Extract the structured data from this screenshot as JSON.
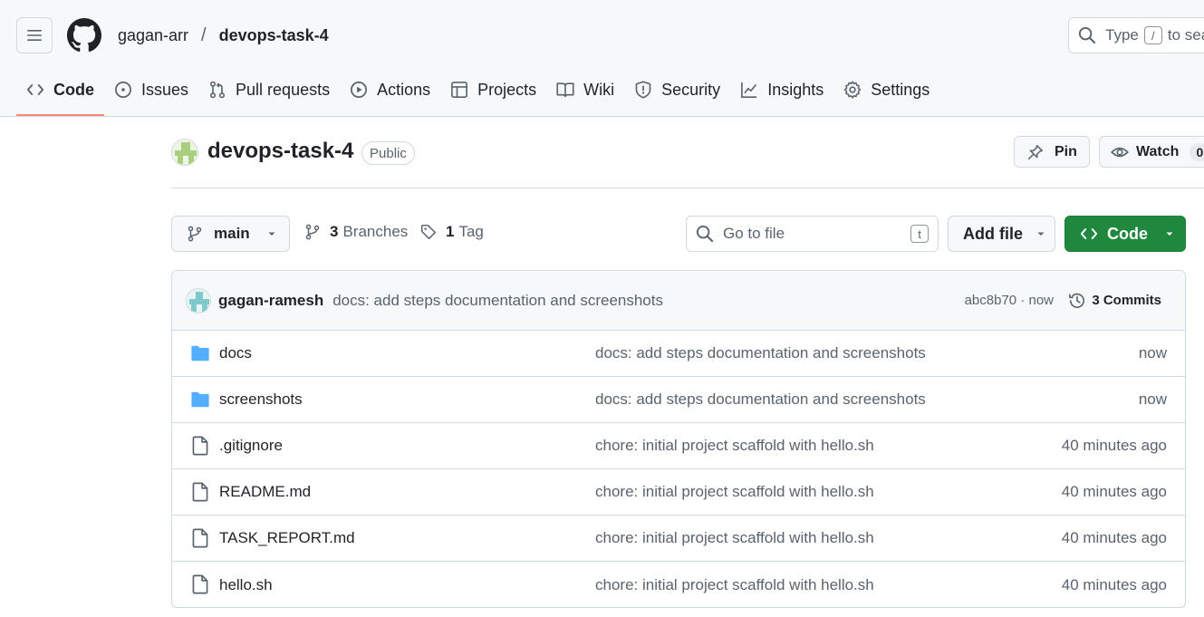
{
  "header": {
    "owner": "gagan-arr",
    "separator": "/",
    "repo": "devops-task-4",
    "search_prefix": "Type",
    "search_key": "/",
    "search_suffix": "to sea"
  },
  "tabs": [
    {
      "label": "Code",
      "icon": "code-icon",
      "selected": true
    },
    {
      "label": "Issues",
      "icon": "issue-icon"
    },
    {
      "label": "Pull requests",
      "icon": "pull-request-icon"
    },
    {
      "label": "Actions",
      "icon": "play-icon"
    },
    {
      "label": "Projects",
      "icon": "table-icon"
    },
    {
      "label": "Wiki",
      "icon": "book-icon"
    },
    {
      "label": "Security",
      "icon": "shield-icon"
    },
    {
      "label": "Insights",
      "icon": "graph-icon"
    },
    {
      "label": "Settings",
      "icon": "gear-icon"
    }
  ],
  "repo_header": {
    "name": "devops-task-4",
    "visibility": "Public",
    "pin_label": "Pin",
    "watch_label": "Watch",
    "watch_count": "0"
  },
  "toolbar": {
    "branch": "main",
    "branches_count": "3",
    "branches_label": "Branches",
    "tags_count": "1",
    "tags_label": "Tag",
    "goto_placeholder": "Go to file",
    "goto_key": "t",
    "add_file_label": "Add file",
    "code_label": "Code"
  },
  "latest_commit": {
    "author": "gagan-ramesh",
    "message": "docs: add steps documentation and screenshots",
    "meta": "abc8b70 · now",
    "commits_label": "3 Commits"
  },
  "files": [
    {
      "type": "folder",
      "name": "docs",
      "message": "docs: add steps documentation and screenshots",
      "time": "now"
    },
    {
      "type": "folder",
      "name": "screenshots",
      "message": "docs: add steps documentation and screenshots",
      "time": "now"
    },
    {
      "type": "file",
      "name": ".gitignore",
      "message": "chore: initial project scaffold with hello.sh",
      "time": "40 minutes ago"
    },
    {
      "type": "file",
      "name": "README.md",
      "message": "chore: initial project scaffold with hello.sh",
      "time": "40 minutes ago"
    },
    {
      "type": "file",
      "name": "TASK_REPORT.md",
      "message": "chore: initial project scaffold with hello.sh",
      "time": "40 minutes ago"
    },
    {
      "type": "file",
      "name": "hello.sh",
      "message": "chore: initial project scaffold with hello.sh",
      "time": "40 minutes ago"
    }
  ],
  "colors": {
    "accent_green": "#1f883d",
    "tab_underline": "#fd8c73",
    "folder_blue": "#54aeff"
  }
}
